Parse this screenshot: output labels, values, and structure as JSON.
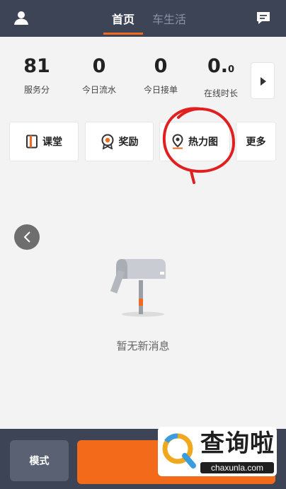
{
  "header": {
    "tabs": [
      {
        "label": "首页",
        "active": true
      },
      {
        "label": "车生活",
        "active": false
      }
    ],
    "icons": [
      "user-icon",
      "message-icon"
    ]
  },
  "stats": [
    {
      "value": "81",
      "label": "服务分"
    },
    {
      "value": "0",
      "label": "今日流水"
    },
    {
      "value": "0",
      "label": "今日接单"
    },
    {
      "value": "0.",
      "value_small": "0",
      "label": "在线时长"
    }
  ],
  "actions": [
    {
      "label": "课堂",
      "icon": "book-icon"
    },
    {
      "label": "奖励",
      "icon": "medal-icon"
    },
    {
      "label": "热力图",
      "icon": "location-pin-icon",
      "highlighted": true
    },
    {
      "label": "更多",
      "icon": ""
    }
  ],
  "empty_state": {
    "icon": "mailbox-icon",
    "text": "暂无新消息"
  },
  "bottom": {
    "mode_label": "模式",
    "accent_color": "#f26a1a"
  },
  "watermark": {
    "title": "查询啦",
    "url": "chaxunla.com"
  },
  "colors": {
    "header_bg": "#3d4456",
    "accent": "#f06a1f",
    "annotation": "#e02020"
  }
}
